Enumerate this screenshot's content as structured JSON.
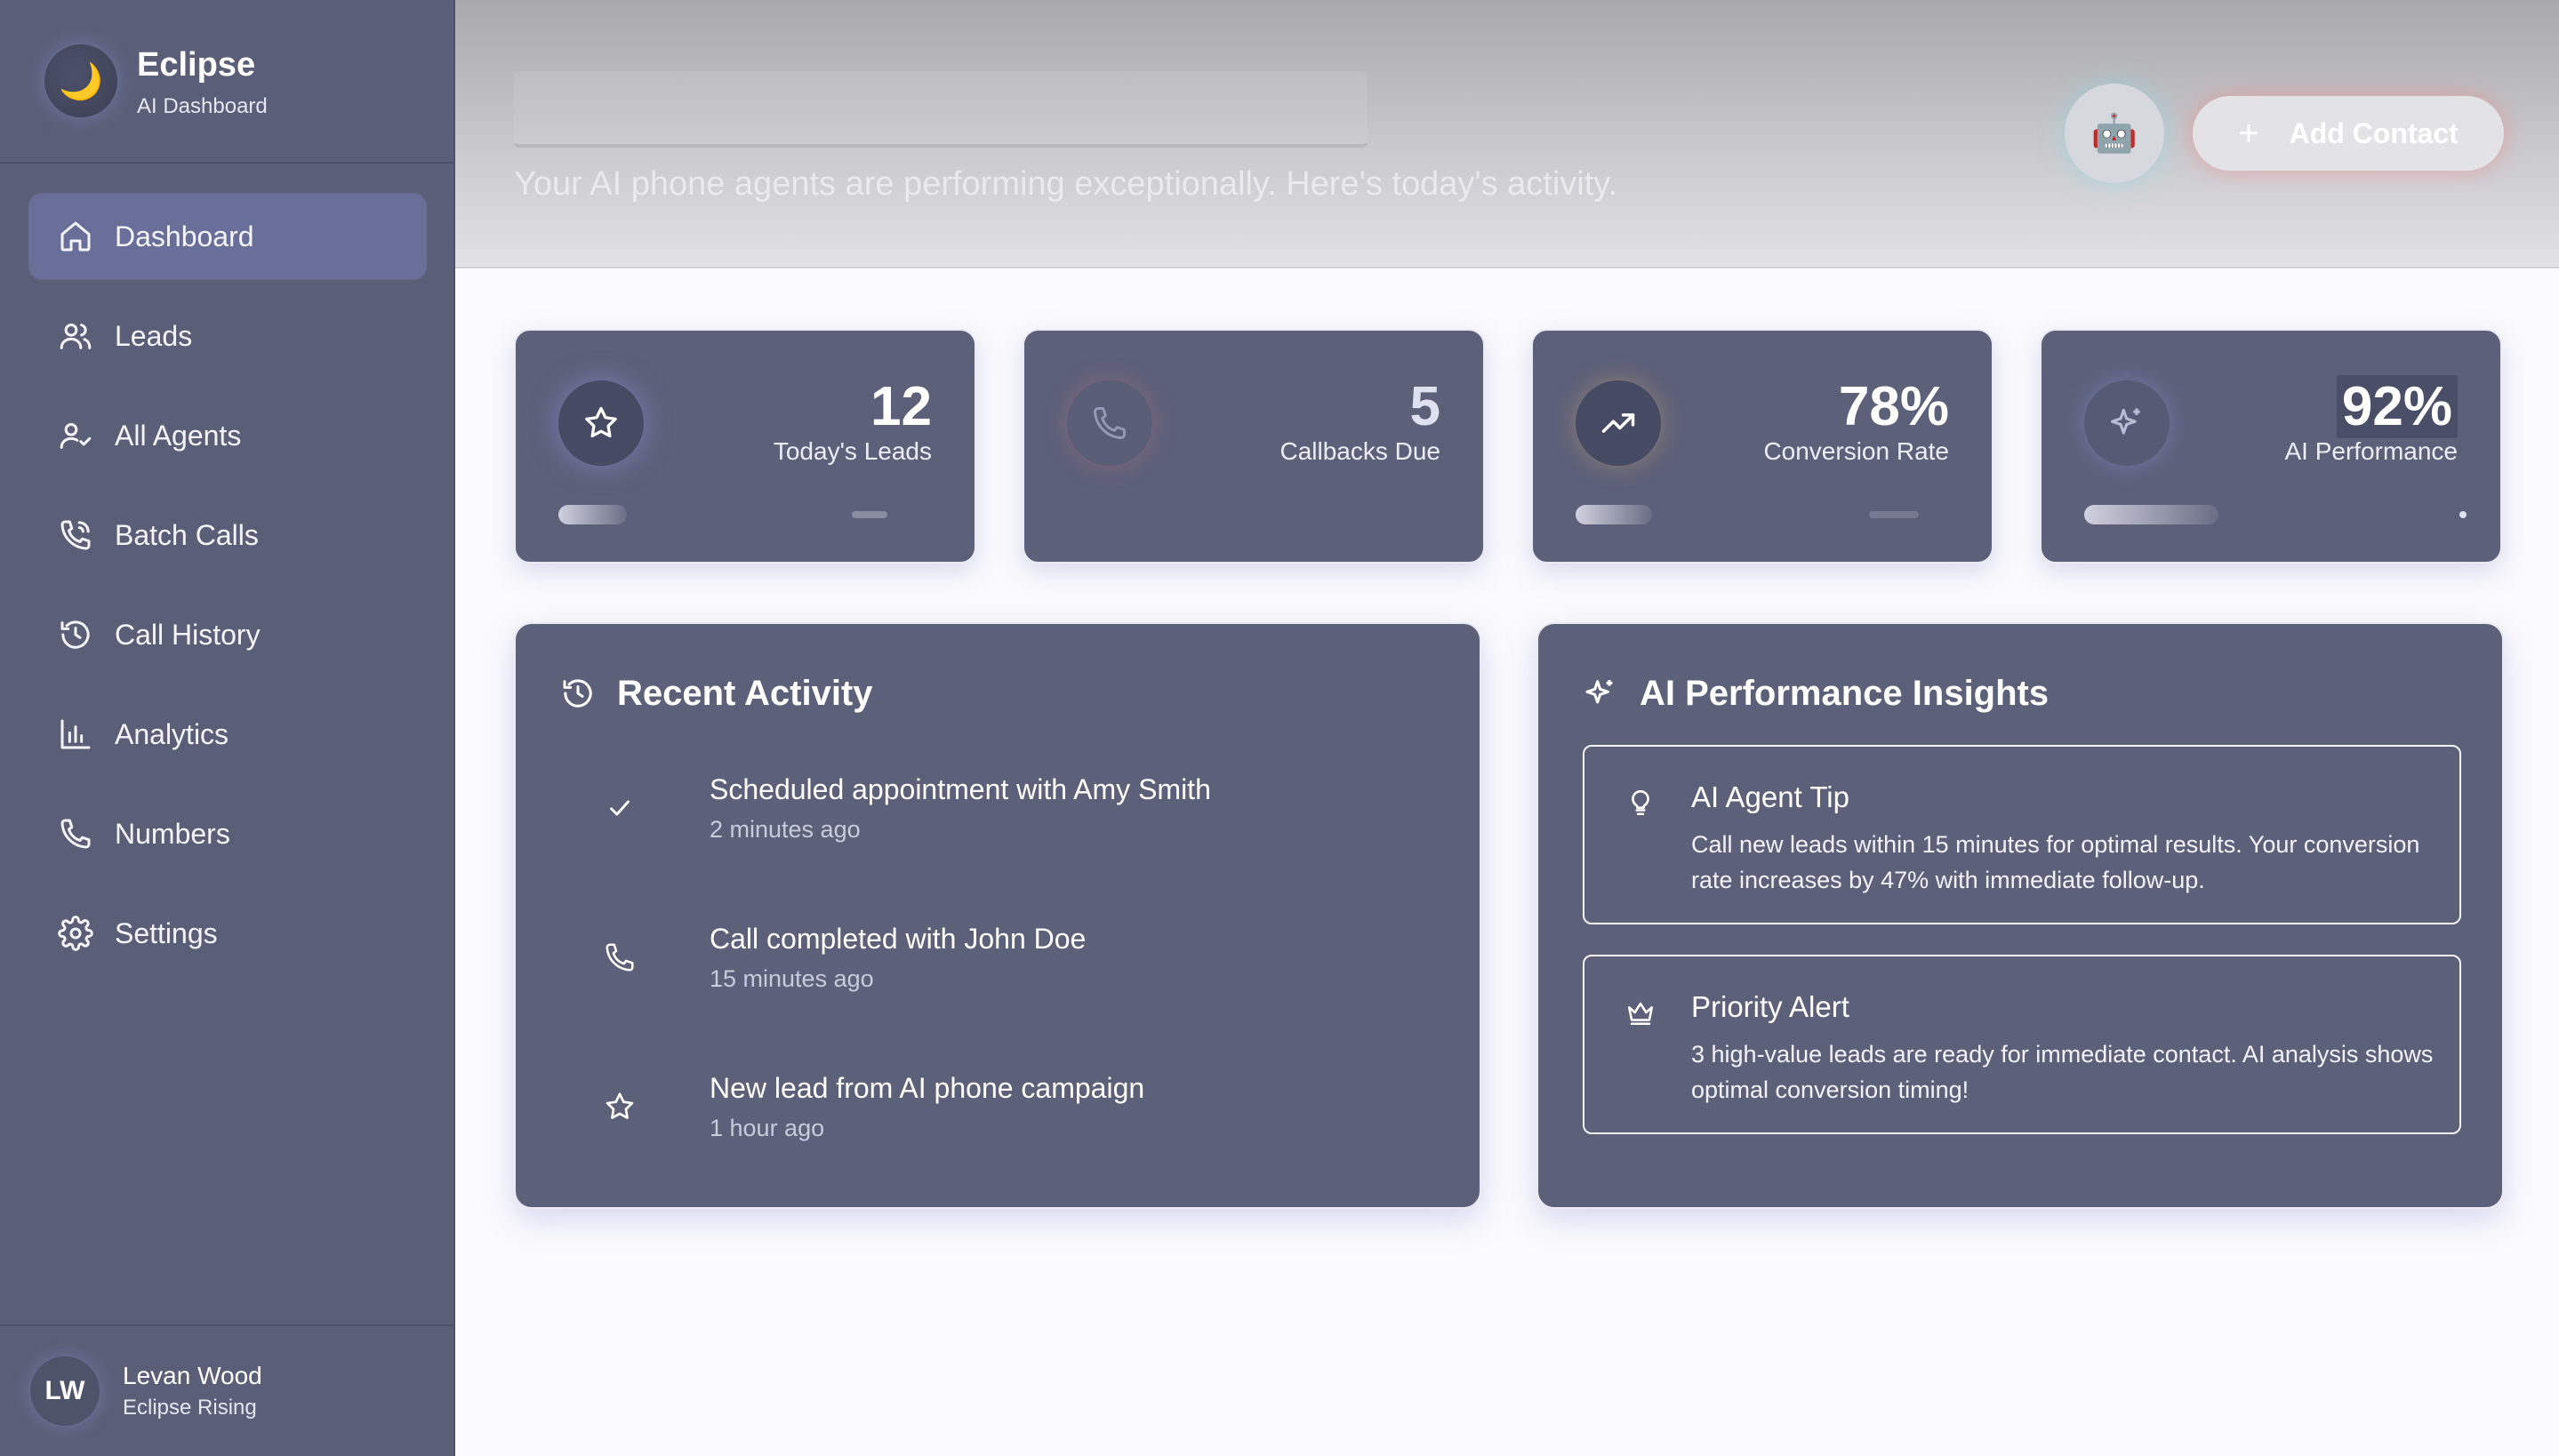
{
  "brand": {
    "title": "Eclipse",
    "subtitle": "AI Dashboard",
    "logo_icon": "moon-icon"
  },
  "nav": [
    {
      "label": "Dashboard",
      "icon": "home-icon",
      "active": true
    },
    {
      "label": "Leads",
      "icon": "users-icon"
    },
    {
      "label": "All Agents",
      "icon": "user-check-icon"
    },
    {
      "label": "Batch Calls",
      "icon": "phone-wave-icon"
    },
    {
      "label": "Call History",
      "icon": "history-icon"
    },
    {
      "label": "Analytics",
      "icon": "bar-chart-icon"
    },
    {
      "label": "Numbers",
      "icon": "phone-icon"
    },
    {
      "label": "Settings",
      "icon": "gear-icon"
    }
  ],
  "user": {
    "initials": "LW",
    "name": "Levan Wood",
    "role": "Eclipse Rising"
  },
  "header": {
    "subtitle": "Your AI phone agents are performing exceptionally. Here's today's activity.",
    "robot_icon": "robot-icon",
    "add_contact_label": "Add Contact",
    "add_icon": "plus-icon"
  },
  "stats": [
    {
      "value": "12",
      "label": "Today's Leads",
      "icon": "star-icon",
      "progress": 0.18
    },
    {
      "value": "5",
      "label": "Callbacks Due",
      "icon": "phone-icon",
      "progress": 0.0
    },
    {
      "value": "78%",
      "label": "Conversion Rate",
      "icon": "trending-up-icon",
      "progress": 0.2
    },
    {
      "value": "92%",
      "label": "AI Performance",
      "icon": "sparkles-icon",
      "progress": 0.35
    }
  ],
  "recent_activity": {
    "title": "Recent Activity",
    "items": [
      {
        "title": "Scheduled appointment with Amy Smith",
        "time": "2 minutes ago",
        "icon": "check-icon"
      },
      {
        "title": "Call completed with John Doe",
        "time": "15 minutes ago",
        "icon": "phone-icon"
      },
      {
        "title": "New lead from AI phone campaign",
        "time": "1 hour ago",
        "icon": "star-icon"
      }
    ]
  },
  "insights": {
    "title": "AI Performance Insights",
    "items": [
      {
        "title": "AI Agent Tip",
        "body": "Call new leads within 15 minutes for optimal results. Your conversion rate increases by 47% with immediate follow-up.",
        "icon": "lightbulb-icon"
      },
      {
        "title": "Priority Alert",
        "body": "3 high-value leads are ready for immediate contact. AI analysis shows optimal conversion timing!",
        "icon": "crown-icon"
      }
    ]
  },
  "colors": {
    "sidebar": "#5b5e77",
    "card": "#5d6079",
    "active_nav": "#6a6f9a",
    "accent_glow": "#8c96dc"
  }
}
